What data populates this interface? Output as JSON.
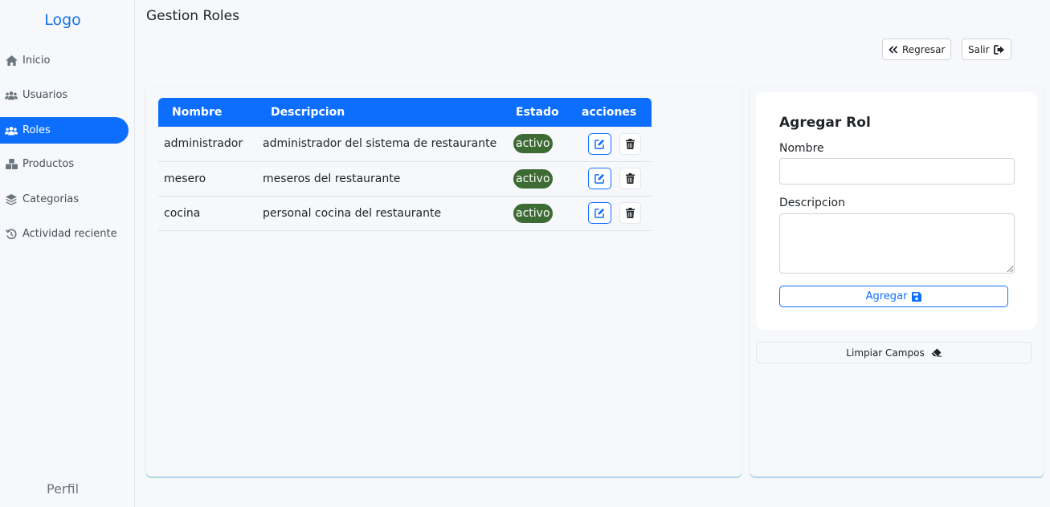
{
  "sidebar": {
    "logo": "Logo",
    "items": [
      {
        "label": "Inicio",
        "icon": "home-icon"
      },
      {
        "label": "Usuarios",
        "icon": "users-icon"
      },
      {
        "label": "Roles",
        "icon": "users-icon",
        "active": true
      },
      {
        "label": "Productos",
        "icon": "boxes-icon"
      },
      {
        "label": "Categorias",
        "icon": "layers-icon"
      },
      {
        "label": "Actividad reciente",
        "icon": "history-icon"
      }
    ],
    "profile": "Perfil"
  },
  "header": {
    "title": "Gestion Roles",
    "back_label": "Regresar",
    "logout_label": "Salir"
  },
  "table": {
    "columns": [
      "Nombre",
      "Descripcion",
      "Estado",
      "acciones"
    ],
    "rows": [
      {
        "nombre": "administrador",
        "descripcion": "administrador del sistema de restaurante",
        "estado": "activo"
      },
      {
        "nombre": "mesero",
        "descripcion": "meseros del restaurante",
        "estado": "activo"
      },
      {
        "nombre": "cocina",
        "descripcion": "personal cocina del restaurante",
        "estado": "activo"
      }
    ]
  },
  "form": {
    "title": "Agregar Rol",
    "name_label": "Nombre",
    "name_value": "",
    "description_label": "Descripcion",
    "description_value": "",
    "submit_label": "Agregar",
    "clear_label": "Limpiar Campos"
  },
  "colors": {
    "accent": "#0d6efd",
    "status_active": "#3d6b34"
  }
}
